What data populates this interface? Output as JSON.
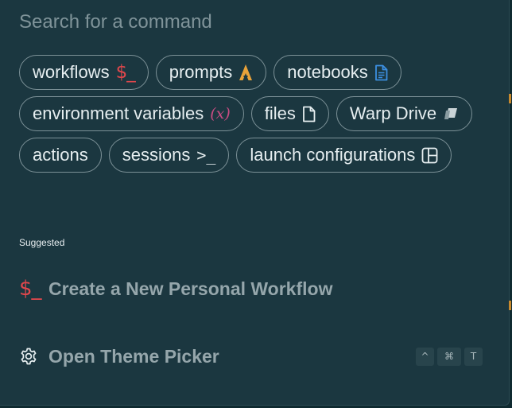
{
  "search": {
    "placeholder": "Search for a command",
    "value": ""
  },
  "filters": [
    {
      "id": "workflows",
      "label": "workflows",
      "icon": "dollar-prompt-icon",
      "glyph": "$_"
    },
    {
      "id": "prompts",
      "label": "prompts",
      "icon": "prompt-a-icon"
    },
    {
      "id": "notebooks",
      "label": "notebooks",
      "icon": "notebook-icon"
    },
    {
      "id": "environment-variables",
      "label": "environment variables",
      "icon": "variable-x-icon",
      "glyph": "(x)"
    },
    {
      "id": "files",
      "label": "files",
      "icon": "file-icon"
    },
    {
      "id": "warp-drive",
      "label": "Warp Drive",
      "icon": "warp-drive-icon"
    },
    {
      "id": "actions",
      "label": "actions"
    },
    {
      "id": "sessions",
      "label": "sessions",
      "icon": "terminal-prompt-icon",
      "glyph": ">_"
    },
    {
      "id": "launch-configurations",
      "label": "launch configurations",
      "icon": "layout-panels-icon"
    }
  ],
  "suggested": {
    "label": "Suggested",
    "items": [
      {
        "id": "create-workflow",
        "label": "Create a New Personal Workflow",
        "icon": "dollar-prompt-icon",
        "glyph": "$_"
      },
      {
        "id": "open-theme-picker",
        "label": "Open Theme Picker",
        "icon": "gear-icon",
        "shortcut": [
          "^",
          "⌘",
          "T"
        ]
      }
    ]
  },
  "colors": {
    "background": "#1b3740",
    "chip_border": "#7c9197",
    "workflow_red": "#e0474c",
    "prompt_orange": "#e8a23a",
    "notebook_blue": "#3c8fe0",
    "variable_pink": "#c94c82",
    "muted_text": "#95a6ab"
  }
}
